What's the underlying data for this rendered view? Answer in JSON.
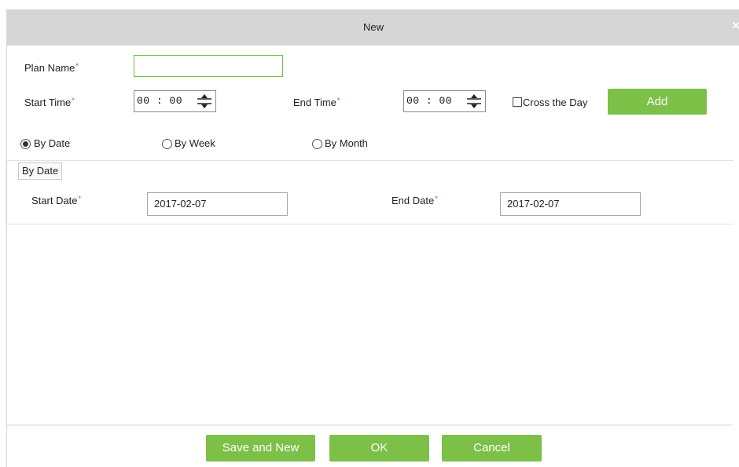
{
  "dialog": {
    "title": "New",
    "close": "×"
  },
  "form": {
    "plan_name": {
      "label": "Plan Name",
      "required_mark": "*",
      "value": ""
    },
    "start_time": {
      "label": "Start Time",
      "required_mark": "*",
      "value": "00 : 00"
    },
    "end_time": {
      "label": "End Time",
      "required_mark": "*",
      "value": "00 : 00"
    },
    "cross_the_day": {
      "label": "Cross the Day",
      "checked": false
    },
    "add_label": "Add"
  },
  "modes": {
    "by_date": {
      "label": "By Date",
      "selected": true
    },
    "by_week": {
      "label": "By Week",
      "selected": false
    },
    "by_month": {
      "label": "By Month",
      "selected": false
    }
  },
  "by_date_section": {
    "legend": "By Date",
    "start_date": {
      "label": "Start Date",
      "required_mark": "*",
      "value": "2017-02-07"
    },
    "end_date": {
      "label": "End Date",
      "required_mark": "*",
      "value": "2017-02-07"
    }
  },
  "footer": {
    "save_and_new": "Save and New",
    "ok": "OK",
    "cancel": "Cancel"
  },
  "colors": {
    "accent_green": "#7cc048",
    "title_bar": "#d6d6d6",
    "required": "#e0322a"
  }
}
